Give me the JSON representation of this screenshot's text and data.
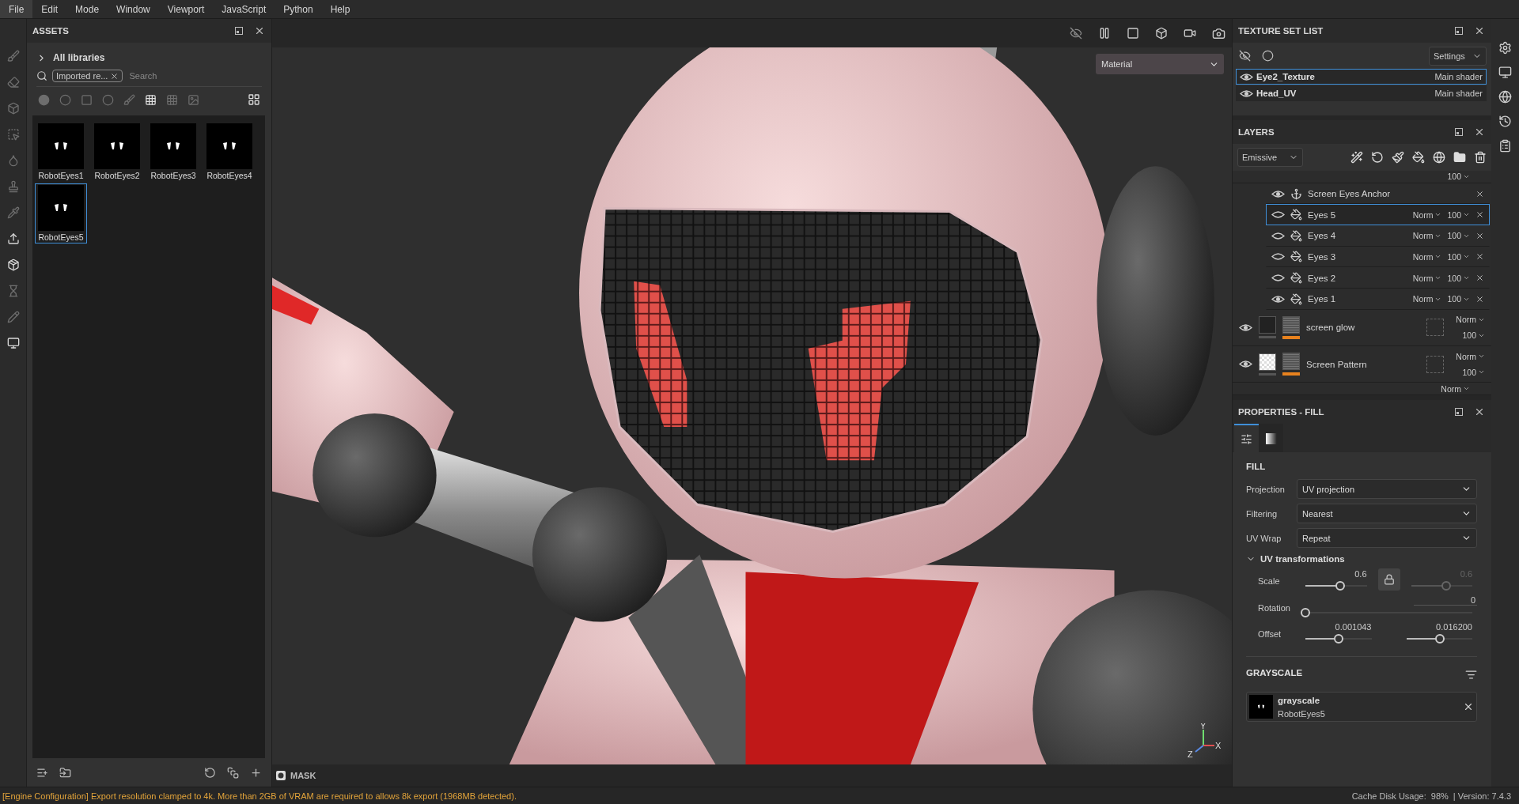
{
  "menu": [
    {
      "label": "File",
      "selected": true
    },
    {
      "label": "Edit",
      "selected": false
    },
    {
      "label": "Mode",
      "selected": false
    },
    {
      "label": "Window",
      "selected": false
    },
    {
      "label": "Viewport",
      "selected": false
    },
    {
      "label": "JavaScript",
      "selected": false
    },
    {
      "label": "Python",
      "selected": false
    },
    {
      "label": "Help",
      "selected": false
    }
  ],
  "assets": {
    "title": "ASSETS",
    "library": "All libraries",
    "filter_tag": "Imported re...",
    "search": {
      "placeholder": "Search"
    },
    "items": [
      {
        "name": "RobotEyes1",
        "selected": false
      },
      {
        "name": "RobotEyes2",
        "selected": false
      },
      {
        "name": "RobotEyes3",
        "selected": false
      },
      {
        "name": "RobotEyes4",
        "selected": false
      },
      {
        "name": "RobotEyes5",
        "selected": true
      }
    ]
  },
  "viewport": {
    "shading": "Material",
    "mask": "MASK",
    "axes": {
      "y": "Y",
      "z": "Z",
      "x": "X"
    }
  },
  "texture_set_list": {
    "title": "TEXTURE SET LIST",
    "settings": "Settings",
    "rows": [
      {
        "name": "Eye2_Texture",
        "shader": "Main shader",
        "selected": true
      },
      {
        "name": "Head_UV",
        "shader": "Main shader",
        "selected": false
      }
    ]
  },
  "layers": {
    "title": "LAYERS",
    "channel": "Emissive",
    "top_partial": {
      "opacity": "100"
    },
    "sublayers": [
      {
        "kind": "anchor",
        "name": "Screen Eyes Anchor",
        "visible": true,
        "selected": false
      },
      {
        "kind": "fill",
        "name": "Eyes 5",
        "visible": false,
        "selected": true,
        "blend": "Norm",
        "opacity": "100"
      },
      {
        "kind": "fill",
        "name": "Eyes 4",
        "visible": false,
        "selected": false,
        "blend": "Norm",
        "opacity": "100"
      },
      {
        "kind": "fill",
        "name": "Eyes 3",
        "visible": false,
        "selected": false,
        "blend": "Norm",
        "opacity": "100"
      },
      {
        "kind": "fill",
        "name": "Eyes 2",
        "visible": false,
        "selected": false,
        "blend": "Norm",
        "opacity": "100"
      },
      {
        "kind": "fill",
        "name": "Eyes 1",
        "visible": true,
        "selected": false,
        "blend": "Norm",
        "opacity": "100"
      }
    ],
    "layers": [
      {
        "name": "screen glow",
        "kind": "dark",
        "visible": true,
        "blend": "Norm",
        "opacity": "100"
      },
      {
        "name": "Screen Pattern",
        "kind": "checker",
        "visible": true,
        "blend": "Norm",
        "opacity": "100"
      }
    ],
    "bottom_partial": {
      "blend": "Norm"
    }
  },
  "properties": {
    "title": "PROPERTIES - FILL",
    "tabs": [
      {
        "kind": "settings",
        "selected": true
      },
      {
        "kind": "gradient",
        "selected": false
      }
    ],
    "section": "FILL",
    "dropdowns": [
      {
        "label": "Projection",
        "value": "UV projection"
      },
      {
        "label": "Filtering",
        "value": "Nearest"
      },
      {
        "label": "UV Wrap",
        "value": "Repeat"
      }
    ],
    "transformations": {
      "label": "UV transformations",
      "expanded": true,
      "scale": {
        "label": "Scale",
        "locked": true,
        "values": [
          {
            "reading": "0.6",
            "level": 0.57,
            "disabled": false
          },
          {
            "reading": "0.6",
            "level": 0.58,
            "disabled": true
          }
        ]
      },
      "rotation": {
        "label": "Rotation",
        "reading": "0",
        "level": 0
      },
      "offset": {
        "label": "Offset",
        "values": [
          {
            "reading": "0.001043",
            "level": 0.5,
            "disabled": false
          },
          {
            "reading": "0.016200",
            "level": 0.51,
            "disabled": false
          }
        ]
      }
    },
    "grayscale": {
      "title": "GRAYSCALE",
      "name": "grayscale",
      "resource": "RobotEyes5"
    }
  },
  "status_bar": {
    "message": "[Engine Configuration] Export resolution clamped to 4k. More than 2GB of VRAM are required to allows 8k export (1968MB detected).",
    "cache": "Cache Disk Usage:",
    "cache_value": "98%",
    "version": "| Version: 7.4.3"
  }
}
